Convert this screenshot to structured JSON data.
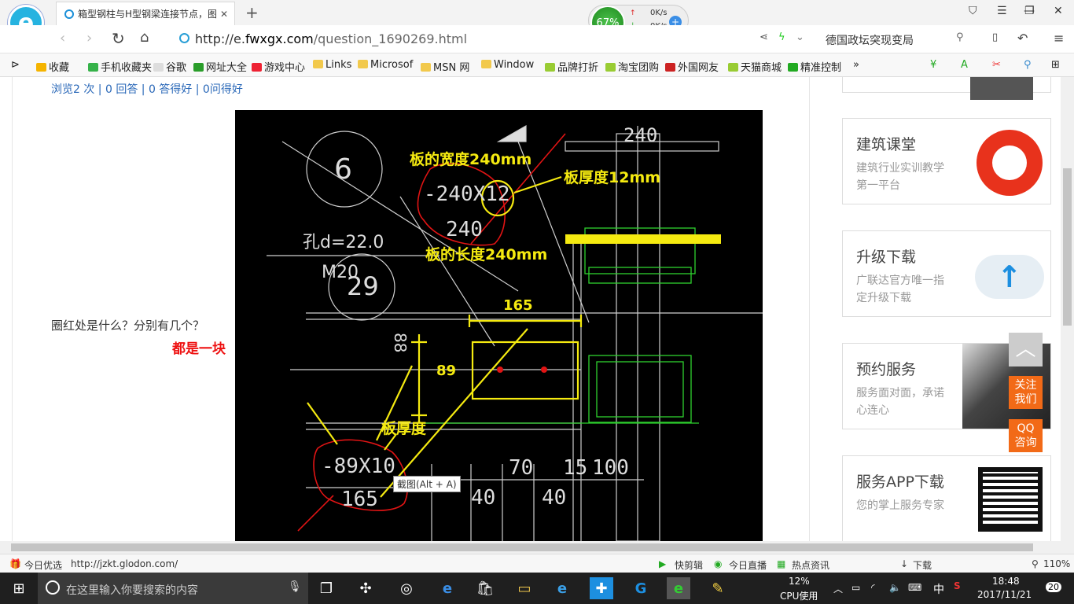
{
  "browser": {
    "tab_title": "箱型钢柱与H型钢梁连接节点，图",
    "url_prefix": "http://e.",
    "url_domain": "fwxgx.com",
    "url_path": "/question_1690269.html",
    "hot_search": "德国政坛突现变局",
    "net_percent": "67%",
    "net_up": "0K/s",
    "net_down": "0K/s"
  },
  "bookmarks": [
    {
      "label": "收藏",
      "color": "#f5b400"
    },
    {
      "label": "手机收藏夹",
      "color": "#36b24a"
    },
    {
      "label": "谷歌",
      "color": "#ddd"
    },
    {
      "label": "网址大全",
      "color": "#2a9d2a"
    },
    {
      "label": "游戏中心",
      "color": "#e23"
    },
    {
      "label": "Links",
      "color": "#f2c94c"
    },
    {
      "label": "Microsof",
      "color": "#f2c94c"
    },
    {
      "label": "MSN 网",
      "color": "#f2c94c"
    },
    {
      "label": "Window",
      "color": "#f2c94c"
    },
    {
      "label": "品牌打折",
      "color": "#9c3"
    },
    {
      "label": "淘宝团购",
      "color": "#9c3"
    },
    {
      "label": "外国网友",
      "color": "#c22"
    },
    {
      "label": "天猫商城",
      "color": "#9c3"
    },
    {
      "label": "精准控制",
      "color": "#2a2"
    }
  ],
  "page": {
    "stats": "浏览2 次 | 0 回答 | 0 答得好 | 0问得好",
    "question": "圈红处是什么？分别有几个？",
    "answer": "都是一块",
    "tooltip": "截图(Alt + A)"
  },
  "cad": {
    "title_width": "板的宽度240mm",
    "title_thick": "板厚度12mm",
    "title_length": "板的长度240mm",
    "dim_165": "165",
    "dim_89": "89",
    "label_thick2": "板厚度",
    "plate1": "-240X12",
    "plate1_len": "240",
    "top_dim": "240",
    "hole": "孔d=22.0",
    "bolt": "M20",
    "circle_num": "6",
    "circle_num2": "29",
    "plate2": "-89X10",
    "plate2_len": "165",
    "dim_88": "88",
    "dim_70": "70",
    "dim_15": "15",
    "dim_100": "100",
    "dim_40a": "40",
    "dim_40b": "40"
  },
  "sidebar": [
    {
      "title": "建筑课堂",
      "sub": "建筑行业实训教学第一平台"
    },
    {
      "title": "升级下载",
      "sub": "广联达官方唯一指定升级下载"
    },
    {
      "title": "预约服务",
      "sub": "服务面对面，承诺心连心"
    },
    {
      "title": "服务APP下载",
      "sub": "您的掌上服务专家"
    }
  ],
  "float": {
    "follow": "关注我们",
    "qq": "QQ咨询"
  },
  "status": {
    "today": "今日优选",
    "link": "http://jzkt.glodon.com/",
    "clip": "快剪辑",
    "live": "今日直播",
    "news": "热点资讯",
    "download": "下载",
    "zoom": "110%"
  },
  "taskbar": {
    "search": "在这里输入你要搜索的内容",
    "cpu_pct": "12%",
    "cpu_label": "CPU使用",
    "ime": "中",
    "time": "18:48",
    "date": "2017/11/21",
    "notif": "20"
  }
}
